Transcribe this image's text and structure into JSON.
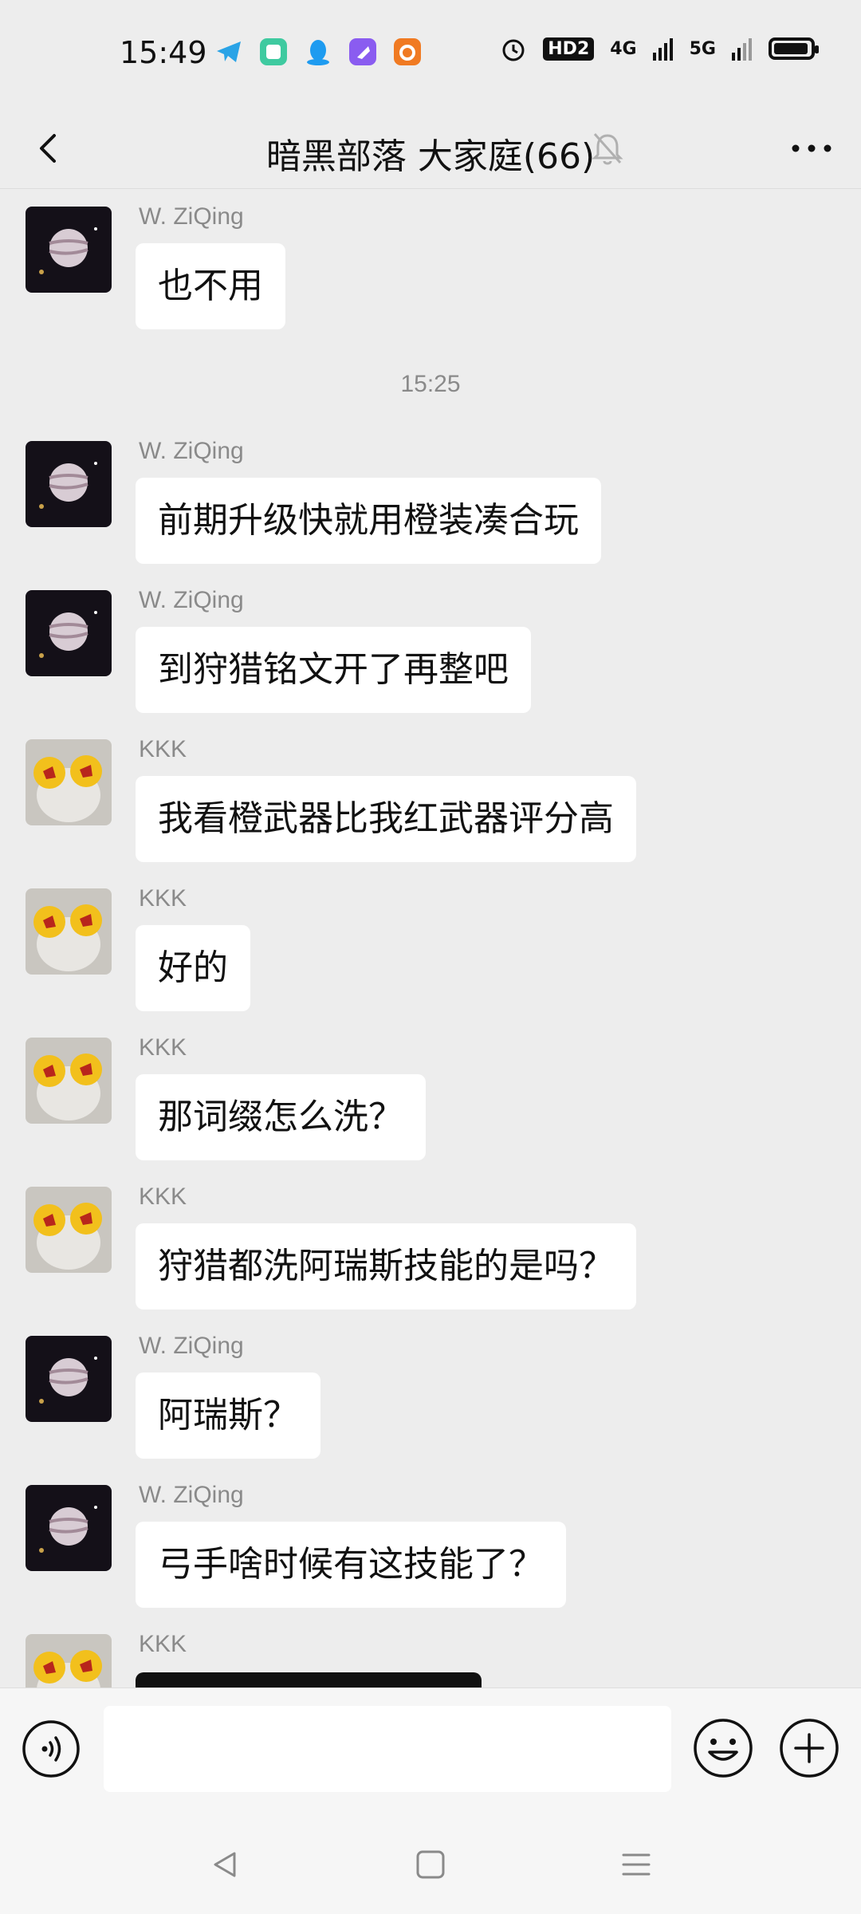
{
  "status_bar": {
    "time": "15:49",
    "app_icons": [
      {
        "name": "telegram-icon",
        "color": "#2aa3e6"
      },
      {
        "name": "app-green-icon",
        "color": "#3fcaa0"
      },
      {
        "name": "qq-icon",
        "color": "#1e9bf0"
      },
      {
        "name": "app-purple-icon",
        "color": "#8a5cf0"
      },
      {
        "name": "uc-browser-icon",
        "color": "#f07a22"
      }
    ],
    "hd_label": "HD2",
    "network_labels": [
      "4G",
      "5G"
    ]
  },
  "header": {
    "title": "暗黑部落 大家庭(66)"
  },
  "messages": [
    {
      "sender": "W. ZiQing",
      "text": "也不用",
      "avatar": "planet"
    },
    {
      "sender": "W. ZiQing",
      "text": "前期升级快就用橙装凑合玩",
      "avatar": "planet"
    },
    {
      "sender": "W. ZiQing",
      "text": "到狩猎铭文开了再整吧",
      "avatar": "planet"
    },
    {
      "sender": "KKK",
      "text": "我看橙武器比我红武器评分高",
      "avatar": "cartoon"
    },
    {
      "sender": "KKK",
      "text": "好的",
      "avatar": "cartoon"
    },
    {
      "sender": "KKK",
      "text": "那词缀怎么洗？",
      "avatar": "cartoon"
    },
    {
      "sender": "KKK",
      "text": "狩猎都洗阿瑞斯技能的是吗？",
      "avatar": "cartoon"
    },
    {
      "sender": "W. ZiQing",
      "text": "阿瑞斯？",
      "avatar": "planet"
    },
    {
      "sender": "W. ZiQing",
      "text": "弓手啥时候有这技能了？",
      "avatar": "planet"
    },
    {
      "sender": "KKK",
      "text": "",
      "avatar": "cartoon"
    }
  ],
  "timestamp": "15:25",
  "input": {
    "value": "",
    "placeholder": ""
  },
  "colors": {
    "background": "#ededed",
    "bubble": "#ffffff",
    "sender_text": "#8a8a8a"
  }
}
